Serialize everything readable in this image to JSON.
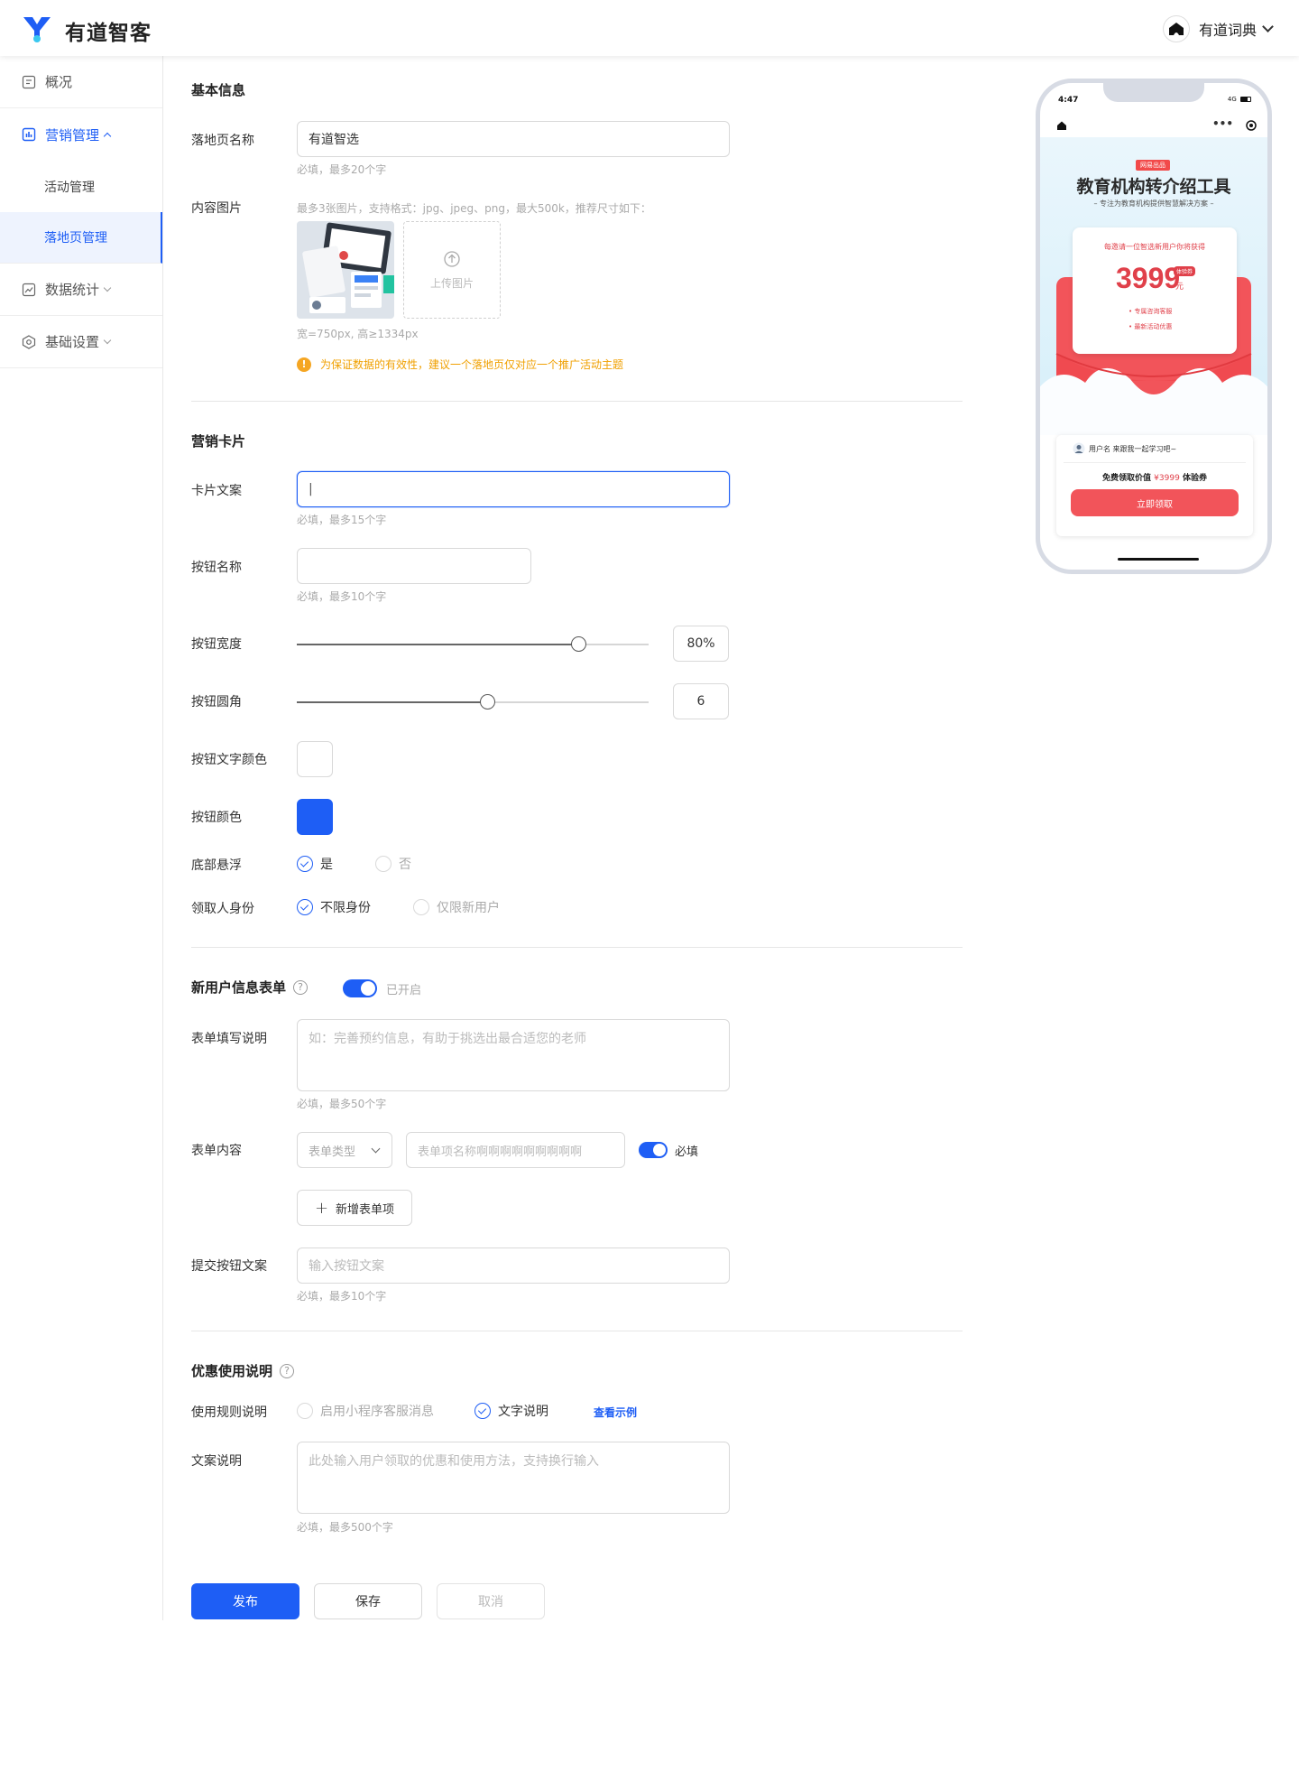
{
  "app": {
    "brand": "有道智客",
    "user_name": "有道词典"
  },
  "sidebar": {
    "items": [
      {
        "label": "概况"
      },
      {
        "label": "营销管理",
        "sub": [
          "活动管理",
          "落地页管理"
        ]
      },
      {
        "label": "数据统计"
      },
      {
        "label": "基础设置"
      }
    ]
  },
  "basic": {
    "title": "基本信息",
    "page_name_label": "落地页名称",
    "page_name_value": "有道智选",
    "page_name_hint": "必填，最多20个字",
    "image_label": "内容图片",
    "image_hint": "最多3张图片，支持格式：jpg、jpeg、png，最大500k，推荐尺寸如下：",
    "upload_label": "上传图片",
    "size_hint": "宽=750px, 高≥1334px",
    "warning": "为保证数据的有效性，建议一个落地页仅对应一个推广活动主题"
  },
  "card": {
    "title": "营销卡片",
    "copy_label": "卡片文案",
    "copy_value": "|",
    "copy_hint": "必填，最多15个字",
    "btn_name_label": "按钮名称",
    "btn_name_hint": "必填，最多10个字",
    "btn_width_label": "按钮宽度",
    "btn_width_value": "80%",
    "btn_width_fraction": 0.8,
    "btn_radius_label": "按钮圆角",
    "btn_radius_value": "6",
    "btn_radius_fraction": 0.54,
    "btn_text_color_label": "按钮文字颜色",
    "btn_text_color": "#ffffff",
    "btn_color_label": "按钮颜色",
    "btn_color": "#1e5ef5",
    "float_label": "底部悬浮",
    "float_yes": "是",
    "float_no": "否",
    "claimer_label": "领取人身份",
    "claimer_any": "不限身份",
    "claimer_new": "仅限新用户"
  },
  "form": {
    "title": "新用户信息表单",
    "toggle_text": "已开启",
    "desc_label": "表单填写说明",
    "desc_placeholder": "如：完善预约信息，有助于挑选出最合适您的老师",
    "desc_hint": "必填，最多50个字",
    "content_label": "表单内容",
    "type_placeholder": "表单类型",
    "item_placeholder": "表单项名称啊啊啊啊啊啊啊啊啊",
    "required_text": "必填",
    "add_item": "新增表单项",
    "submit_label": "提交按钮文案",
    "submit_placeholder": "输入按钮文案",
    "submit_hint": "必填，最多10个字"
  },
  "coupon": {
    "title": "优惠使用说明",
    "rule_label": "使用规则说明",
    "rule_opt1": "启用小程序客服消息",
    "rule_opt2": "文字说明",
    "example_link": "查看示例",
    "copy_label": "文案说明",
    "copy_placeholder": "此处输入用户领取的优惠和使用方法，支持换行输入",
    "copy_hint": "必填，最多500个字"
  },
  "actions": {
    "publish": "发布",
    "save": "保存",
    "cancel": "取消"
  },
  "preview": {
    "time": "4:47",
    "signal": "4G",
    "tag": "网易出品",
    "title": "教育机构转介绍工具",
    "subtitle": "– 专注为教育机构提供智慧解决方案 –",
    "invite_text": "每邀请一位智选新用户你将获得",
    "amount": "3999",
    "amount_badge": "体验券",
    "amount_unit": "元",
    "benefit1": "• 专属咨询客服",
    "benefit2": "• 最新活动优惠",
    "user_line": "用户名  来跟我一起学习吧~",
    "value_prefix": "免费领取价值 ",
    "value_amount": "¥3999",
    "value_suffix": " 体验券",
    "cta": "立即领取"
  }
}
